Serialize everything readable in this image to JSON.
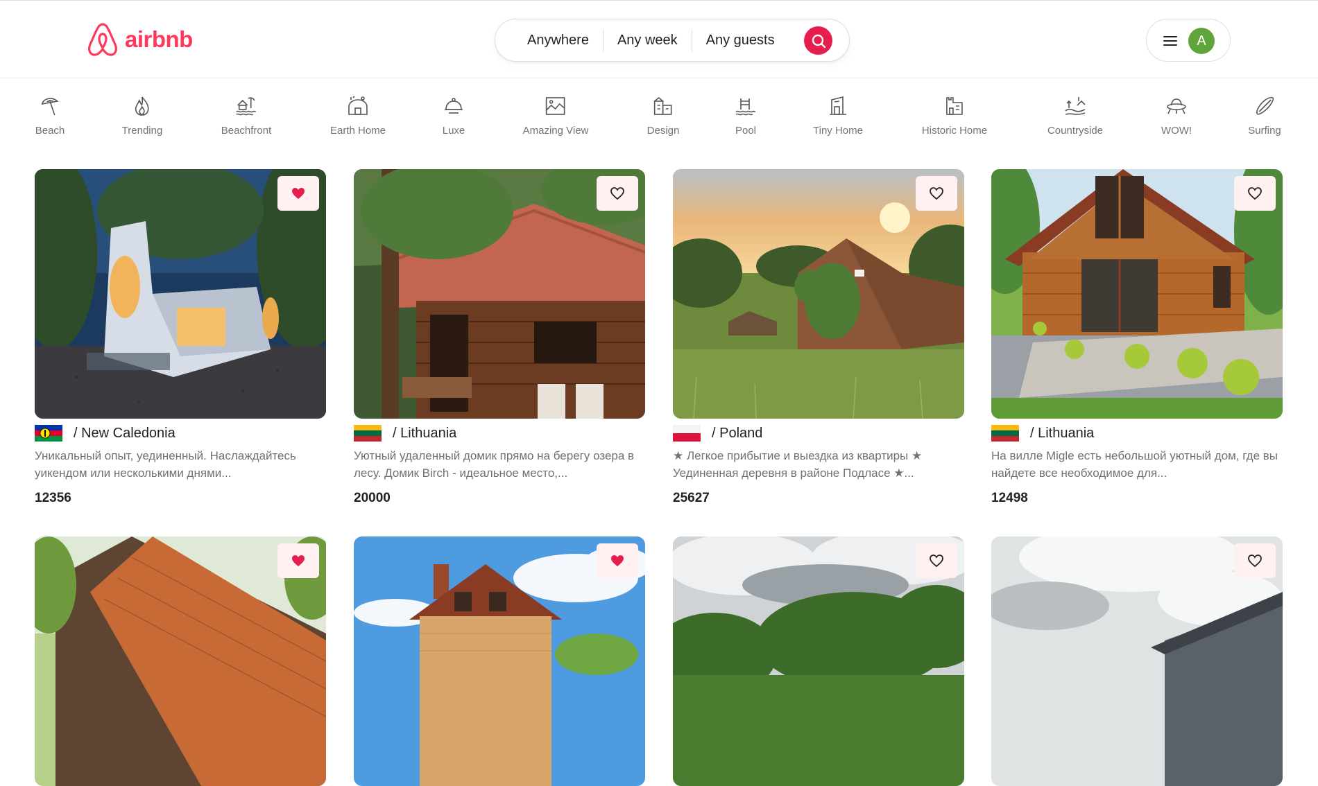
{
  "brand": {
    "name": "airbnb",
    "color": "#ff385c"
  },
  "search": {
    "where": "Anywhere",
    "when": "Any week",
    "who": "Any guests",
    "button_icon": "search-icon",
    "button_color": "#e61e4d"
  },
  "user_menu": {
    "menu_icon": "hamburger-menu-icon",
    "avatar_letter": "A",
    "avatar_color": "#5fa53b"
  },
  "categories": [
    {
      "label": "Beach",
      "icon": "beach-umbrella-icon"
    },
    {
      "label": "Trending",
      "icon": "flame-icon"
    },
    {
      "label": "Beachfront",
      "icon": "beachfront-icon"
    },
    {
      "label": "Earth Home",
      "icon": "earth-home-icon"
    },
    {
      "label": "Luxe",
      "icon": "luxe-bell-icon"
    },
    {
      "label": "Amazing View",
      "icon": "picture-frame-icon"
    },
    {
      "label": "Design",
      "icon": "building-icon"
    },
    {
      "label": "Pool",
      "icon": "pool-icon"
    },
    {
      "label": "Tiny Home",
      "icon": "tiny-home-icon"
    },
    {
      "label": "Historic Home",
      "icon": "castle-icon"
    },
    {
      "label": "Countryside",
      "icon": "countryside-icon"
    },
    {
      "label": "WOW!",
      "icon": "ufo-icon"
    },
    {
      "label": "Surfing",
      "icon": "surfboard-icon"
    }
  ],
  "listings": [
    {
      "location": "/ New Caledonia",
      "flag": "new-caledonia-flag",
      "description": "Уникальный опыт, уединенный. Наслаждайтесь уикендом или несколькими днями...",
      "price": "12356",
      "favorited": true,
      "photo": "modern white house in forest at dusk"
    },
    {
      "location": "/ Lithuania",
      "flag": "lithuania-flag",
      "description": "Уютный удаленный домик прямо на берегу озера в лесу. Домик Birch - идеальное место,...",
      "price": "20000",
      "favorited": false,
      "photo": "wooden cabin under pine trees"
    },
    {
      "location": "/ Poland",
      "flag": "poland-flag",
      "description": "★ Легкое прибытие и выездка из квартиры ★ Уединенная деревня в районе Подласе ★...",
      "price": "25627",
      "favorited": false,
      "photo": "ivy covered brick cottage at sunset"
    },
    {
      "location": "/ Lithuania",
      "flag": "lithuania-flag",
      "description": "На вилле Migle есть небольшой уютный дом, где вы найдете все необходимое для...",
      "price": "12498",
      "favorited": false,
      "photo": "wooden chalet with garden"
    },
    {
      "favorited": true,
      "photo": "house with orange tiled roof"
    },
    {
      "favorited": true,
      "photo": "brick house under blue sky"
    },
    {
      "favorited": false,
      "photo": "trees under cloudy sky"
    },
    {
      "favorited": false,
      "photo": "modern house under bright sky"
    }
  ]
}
